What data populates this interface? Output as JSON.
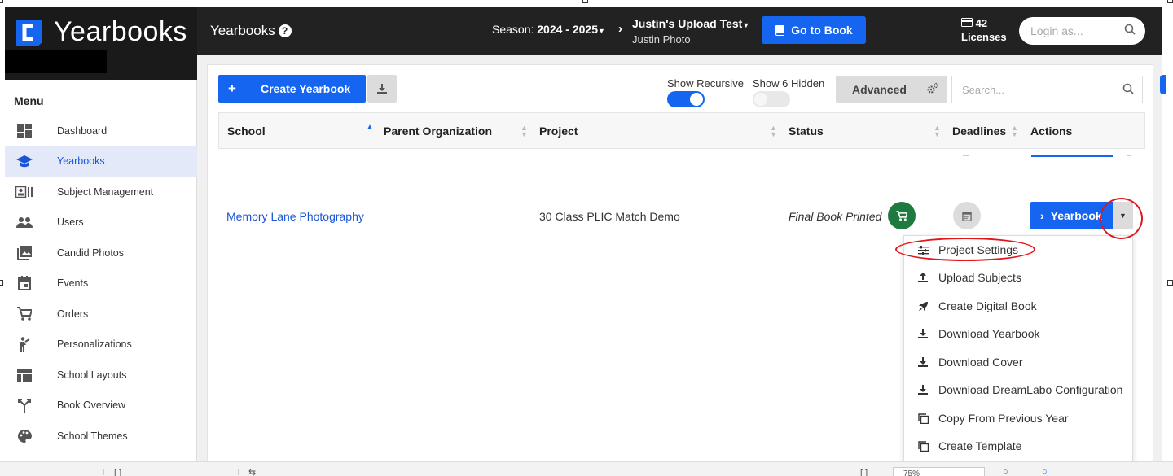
{
  "app": {
    "logo_text": "Yearbooks",
    "page_title": "Yearbooks",
    "help_icon": "question-icon"
  },
  "header": {
    "season_label": "Season: ",
    "season_value": "2024 - 2025",
    "account_title": "Justin's Upload Test",
    "account_sub": "Justin Photo",
    "go_to_book": "Go to Book",
    "licenses_count": "42",
    "licenses_label": "Licenses",
    "login_placeholder": "Login as..."
  },
  "sidebar": {
    "menu_title": "Menu",
    "items": [
      {
        "label": "Dashboard",
        "icon": "dashboard-icon"
      },
      {
        "label": "Yearbooks",
        "icon": "graduation-cap-icon"
      },
      {
        "label": "Subject Management",
        "icon": "subject-card-icon"
      },
      {
        "label": "Users",
        "icon": "users-icon"
      },
      {
        "label": "Candid Photos",
        "icon": "photos-icon"
      },
      {
        "label": "Events",
        "icon": "calendar-icon"
      },
      {
        "label": "Orders",
        "icon": "cart-icon"
      },
      {
        "label": "Personalizations",
        "icon": "person-icon"
      },
      {
        "label": "School Layouts",
        "icon": "layout-icon"
      },
      {
        "label": "Book Overview",
        "icon": "split-arrows-icon"
      },
      {
        "label": "School Themes",
        "icon": "palette-icon"
      }
    ],
    "active_index": 1
  },
  "toolbar": {
    "create_label": "Create Yearbook",
    "show_recursive": "Show Recursive",
    "show_hidden": "Show 6 Hidden",
    "advanced": "Advanced",
    "search_placeholder": "Search...",
    "recursive_on": true,
    "hidden_on": false
  },
  "table": {
    "columns": [
      "School",
      "Parent Organization",
      "Project",
      "Status",
      "Deadlines",
      "Actions"
    ],
    "row": {
      "school": "Memory Lane Photography",
      "parent": "",
      "project": "30 Class PLIC Match Demo",
      "status": "Final Book Printed",
      "action_button": "Yearbook"
    }
  },
  "dropdown": {
    "items": [
      {
        "label": "Project Settings",
        "icon": "sliders-icon"
      },
      {
        "label": "Upload Subjects",
        "icon": "upload-icon"
      },
      {
        "label": "Create Digital Book",
        "icon": "rocket-icon"
      },
      {
        "label": "Download Yearbook",
        "icon": "download-icon"
      },
      {
        "label": "Download Cover",
        "icon": "download-icon"
      },
      {
        "label": "Download DreamLabo Configuration",
        "icon": "download-icon"
      },
      {
        "label": "Copy From Previous Year",
        "icon": "copy-icon"
      },
      {
        "label": "Create Template",
        "icon": "copy-icon"
      }
    ]
  },
  "colors": {
    "primary": "#1565f0",
    "topbar": "#222222",
    "active_bg": "#e3e9f9",
    "cart_green": "#1f7a3f",
    "annotation_red": "#e0161b"
  },
  "bottom_bar": {
    "zoom": "75%"
  }
}
